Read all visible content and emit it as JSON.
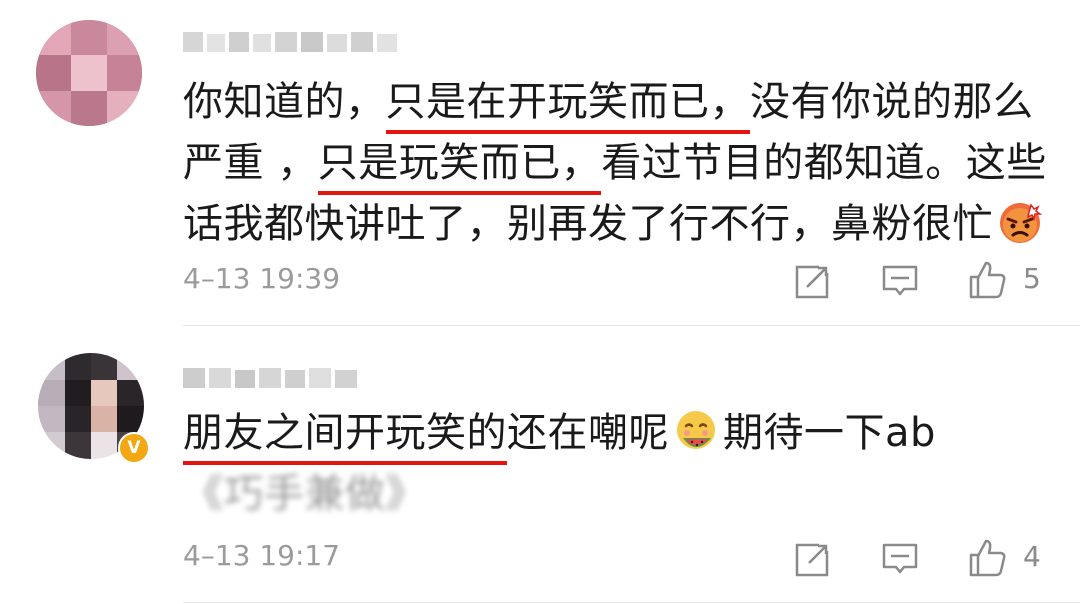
{
  "comments": [
    {
      "username": "",
      "segments": [
        {
          "text": "你知道的，",
          "hl": false
        },
        {
          "text": "只是在开玩笑而已，",
          "hl": true
        },
        {
          "text": "没有你说的那么严重 ，",
          "hl": false
        },
        {
          "text": "只是玩笑而已，",
          "hl": true
        },
        {
          "text": "看过节目的都知道。这些话我都快讲吐了，别再发了行不行，鼻粉很忙",
          "hl": false
        }
      ],
      "emoji_icon": "angry-face-emoji",
      "timestamp": "4–13 19:39",
      "like_count": "5",
      "verified": false
    },
    {
      "username": "",
      "segments": [
        {
          "text": "朋友之间开玩笑的",
          "hl": true
        },
        {
          "text": "还在嘲呢",
          "hl": false
        }
      ],
      "emoji_icon": "eating-melon-emoji",
      "after_emoji": "期待一下ab",
      "blurred_tail": "《巧手兼做》",
      "timestamp": "4–13 19:17",
      "like_count": "4",
      "verified": true,
      "verified_mark": "V"
    }
  ],
  "icons": {
    "share": "share-icon",
    "reply": "comment-icon",
    "like": "thumbs-up-icon"
  },
  "colors": {
    "highlight_underline": "#e4140e",
    "verified_badge": "#f3a712",
    "meta_text": "#9b9b9b"
  }
}
